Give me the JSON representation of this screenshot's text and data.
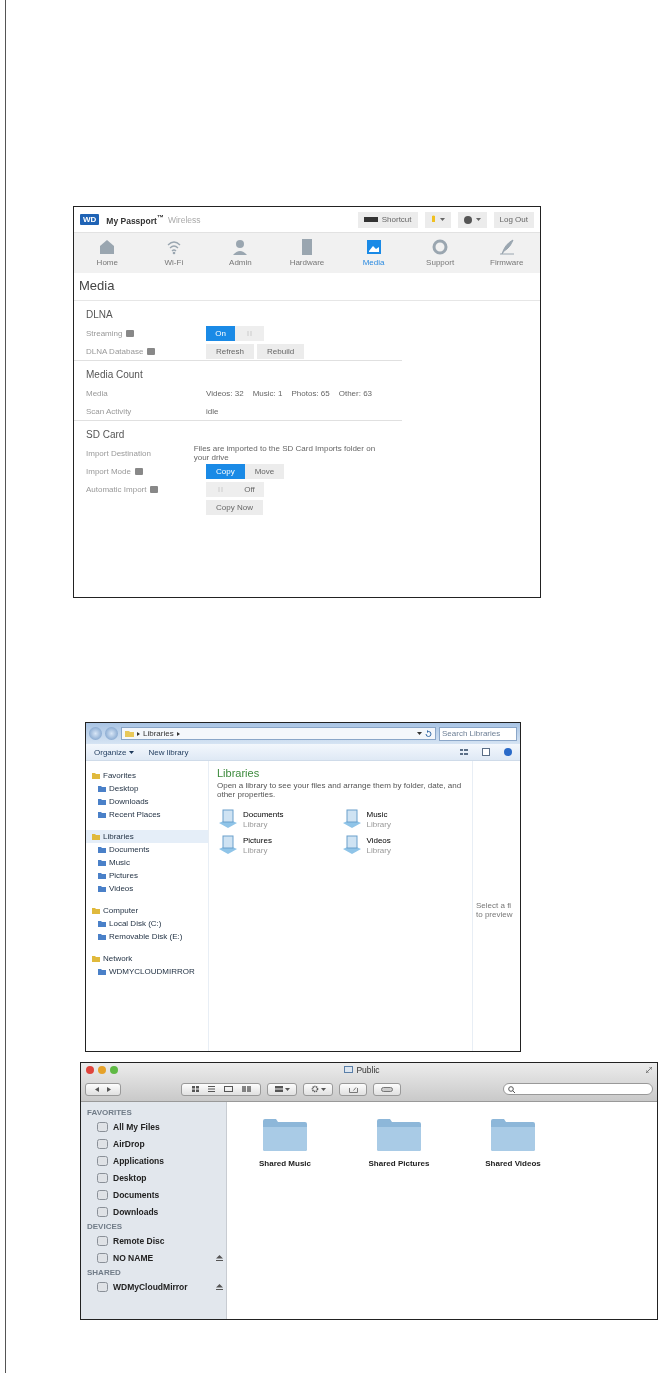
{
  "wd_panel": {
    "logo": "WD",
    "product": "My Passport$^{™}$",
    "product_suffix": "Wireless",
    "header_buttons": [
      {
        "kind": "drive",
        "label": "Shortcut"
      },
      {
        "kind": "alert"
      },
      {
        "kind": "help"
      },
      {
        "kind": "plain",
        "label": "Log Out"
      }
    ],
    "nav": [
      {
        "label": "Home",
        "selected": false
      },
      {
        "label": "Wi-Fi",
        "selected": false
      },
      {
        "label": "Admin",
        "selected": false
      },
      {
        "label": "Hardware",
        "selected": false
      },
      {
        "label": "Media",
        "selected": true
      },
      {
        "label": "Support",
        "selected": false
      },
      {
        "label": "Firmware",
        "selected": false
      }
    ],
    "page_title": "Media",
    "sections": [
      {
        "title": "DLNA",
        "rows": [
          {
            "kind": "toggle",
            "label": "Streaming",
            "info": true,
            "toggle": {
              "on": true,
              "label": "On"
            }
          },
          {
            "kind": "buttons",
            "label": "DLNA Database",
            "info": true,
            "buttons": [
              "Refresh",
              "Rebuild"
            ]
          }
        ]
      },
      {
        "title": "Media Count",
        "rows": [
          {
            "kind": "counts",
            "label": "Media",
            "info": false,
            "counts": [
              "Videos: 32",
              "Music: 1",
              "Photos: 65",
              "Other: 63"
            ]
          },
          {
            "kind": "text",
            "label": "Scan Activity",
            "info": false,
            "value": "idle"
          }
        ]
      },
      {
        "title": "SD Card",
        "rows": [
          {
            "kind": "text",
            "label": "Import Destination",
            "info": false,
            "value": "Files are imported to the SD Card Imports folder on your drive"
          },
          {
            "kind": "segmented",
            "label": "Import Mode",
            "info": true,
            "options": [
              {
                "label": "Copy",
                "selected": true
              },
              {
                "label": "Move",
                "selected": false
              }
            ]
          },
          {
            "kind": "toggle",
            "label": "Automatic Import",
            "info": true,
            "toggle": {
              "on": false,
              "label": "Off"
            }
          },
          {
            "kind": "buttons",
            "info": false,
            "buttons": [
              "Copy Now"
            ]
          }
        ]
      }
    ]
  },
  "explorer": {
    "address": [
      "Libraries"
    ],
    "search": {
      "placeholder": "Search Libraries"
    },
    "toolbar": [
      {
        "label": "Organize",
        "dropdown": true
      },
      {
        "label": "New library",
        "dropdown": false
      }
    ],
    "sidebar": [
      {
        "label": "Favorites",
        "selected": false,
        "children": [
          {
            "label": "Desktop",
            "selected": false
          },
          {
            "label": "Downloads",
            "selected": false
          },
          {
            "label": "Recent Places",
            "selected": false
          }
        ]
      },
      {
        "label": "Libraries",
        "selected": true,
        "children": [
          {
            "label": "Documents",
            "selected": false
          },
          {
            "label": "Music",
            "selected": false
          },
          {
            "label": "Pictures",
            "selected": false
          },
          {
            "label": "Videos",
            "selected": false
          }
        ]
      },
      {
        "label": "Computer",
        "selected": false,
        "children": [
          {
            "label": "Local Disk (C:)",
            "selected": false
          },
          {
            "label": "Removable Disk (E:)",
            "selected": false
          }
        ]
      },
      {
        "label": "Network",
        "selected": false,
        "children": [
          {
            "label": "WDMYCLOUDMIRROR",
            "selected": false
          }
        ]
      }
    ],
    "title": "Libraries",
    "description": "Open a library to see your files and arrange them by folder, date, and other properties.",
    "libraries": [
      {
        "name": "Documents",
        "type": "Library"
      },
      {
        "name": "Music",
        "type": "Library"
      },
      {
        "name": "Pictures",
        "type": "Library"
      },
      {
        "name": "Videos",
        "type": "Library"
      }
    ],
    "preview_lines": [
      "Select a fi",
      "to preview"
    ]
  },
  "finder": {
    "title": "Public",
    "sidebar": [
      {
        "heading": "FAVORITES",
        "items": [
          {
            "label": "All My Files",
            "eject": false
          },
          {
            "label": "AirDrop",
            "eject": false
          },
          {
            "label": "Applications",
            "eject": false
          },
          {
            "label": "Desktop",
            "eject": false
          },
          {
            "label": "Documents",
            "eject": false
          },
          {
            "label": "Downloads",
            "eject": false
          }
        ]
      },
      {
        "heading": "DEVICES",
        "items": [
          {
            "label": "Remote Disc",
            "eject": false
          },
          {
            "label": "NO NAME",
            "eject": true
          }
        ]
      },
      {
        "heading": "SHARED",
        "items": [
          {
            "label": "WDMyCloudMirror",
            "eject": true
          }
        ]
      }
    ],
    "folders": [
      "Shared Music",
      "Shared Pictures",
      "Shared Videos"
    ]
  }
}
